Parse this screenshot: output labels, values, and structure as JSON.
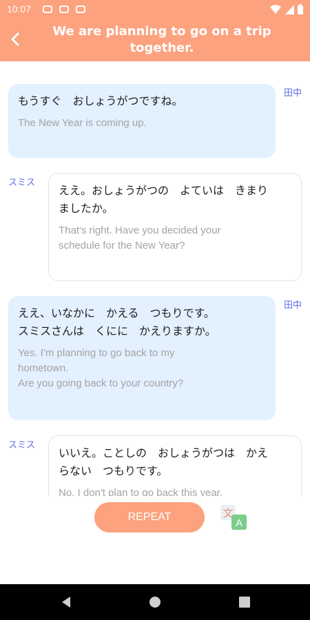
{
  "status_bar": {
    "time": "10:07"
  },
  "header": {
    "title": "We are planning to go on a trip together."
  },
  "messages": [
    {
      "speaker": "田中",
      "jp": "もうすぐ　おしょうがつですね。",
      "en": "The New Year is coming up."
    },
    {
      "speaker": "スミス",
      "jp": "ええ。おしょうがつの　よていは　きまり\nましたか。",
      "en": "That's right. Have you decided your\nschedule for the New Year?"
    },
    {
      "speaker": "田中",
      "jp": "ええ、いなかに　かえる　つもりです。\nスミスさんは　くにに　かえりますか。",
      "en": "Yes. I'm planning to go back to my\nhometown.\nAre you going back to your country?"
    },
    {
      "speaker": "スミス",
      "jp": "いいえ。ことしの　おしょうがつは　かえ\nらない　つもりです。",
      "en": "No, I don't plan to go back this year."
    }
  ],
  "controls": {
    "repeat_label": "REPEAT",
    "translate_icon": {
      "top": "文",
      "bottom": "A"
    }
  },
  "colors": {
    "accent": "#fca27e",
    "bubble_left": "#e3f0fe",
    "speaker": "#5b6ee6"
  }
}
